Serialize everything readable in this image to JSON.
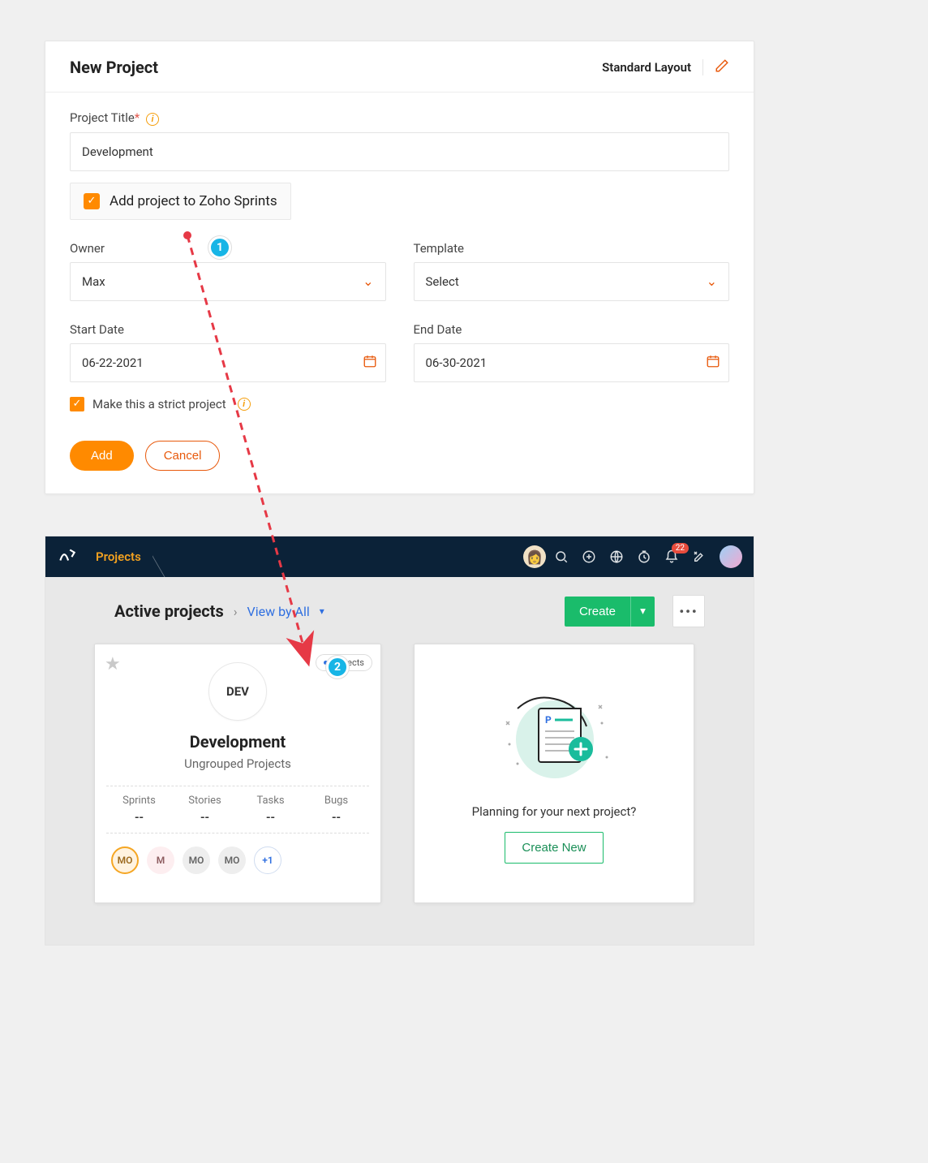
{
  "modal": {
    "title": "New Project",
    "layout_label": "Standard Layout",
    "project_title_label": "Project Title",
    "project_title_value": "Development",
    "add_to_sprints_label": "Add project to Zoho Sprints",
    "owner_label": "Owner",
    "owner_value": "Max",
    "template_label": "Template",
    "template_value": "Select",
    "start_date_label": "Start Date",
    "start_date_value": "06-22-2021",
    "end_date_label": "End Date",
    "end_date_value": "06-30-2021",
    "strict_label": "Make this a strict project",
    "add_button": "Add",
    "cancel_button": "Cancel"
  },
  "annotations": {
    "step1": "1",
    "step2": "2"
  },
  "sprints": {
    "nav_tab": "Projects",
    "notification_count": "22",
    "heading": "Active projects",
    "view_by": "View by All",
    "create_button": "Create",
    "card": {
      "abbr": "DEV",
      "tag": "Projects",
      "title": "Development",
      "subtitle": "Ungrouped Projects",
      "stats": [
        {
          "label": "Sprints",
          "value": "--"
        },
        {
          "label": "Stories",
          "value": "--"
        },
        {
          "label": "Tasks",
          "value": "--"
        },
        {
          "label": "Bugs",
          "value": "--"
        }
      ],
      "avatars": [
        "MO",
        "M",
        "MO",
        "MO"
      ],
      "avatars_more": "+1"
    },
    "empty_card": {
      "text": "Planning for your next project?",
      "button": "Create New"
    }
  }
}
